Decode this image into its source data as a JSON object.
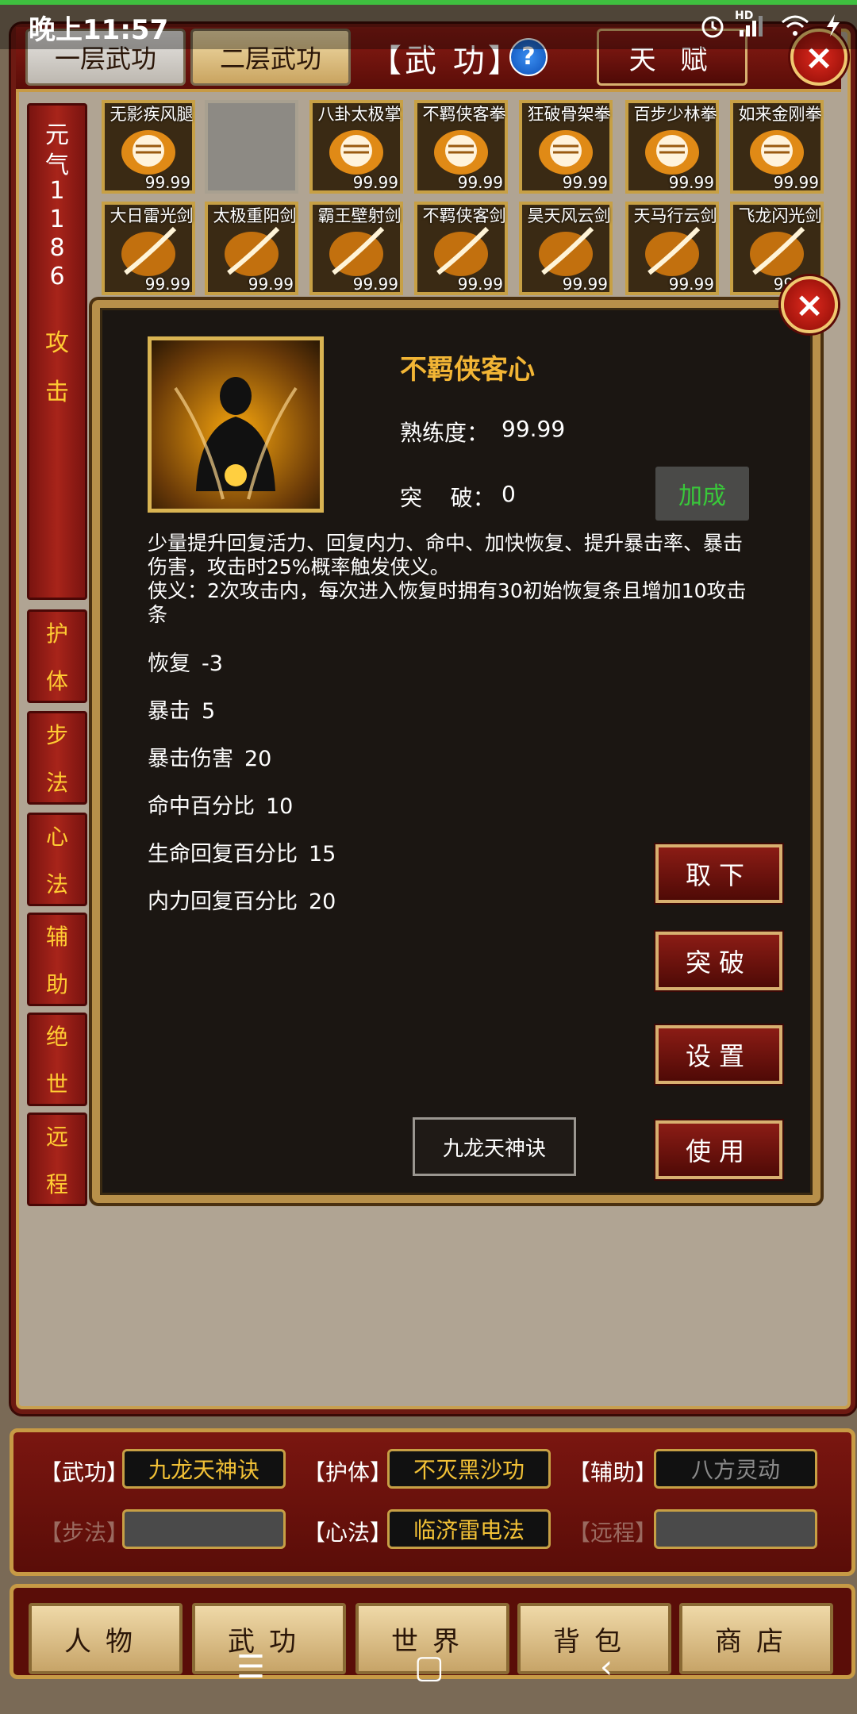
{
  "status_bar": {
    "time": "晚上11:57",
    "hd_label": "HD"
  },
  "header": {
    "tabs": [
      "一层武功",
      "二层武功"
    ],
    "title": "【武  功】",
    "help": "?",
    "talent_button": "天 赋"
  },
  "sidebar": {
    "energy_label": [
      "元",
      "气"
    ],
    "energy_value": [
      "1",
      "1",
      "8",
      "6"
    ],
    "attack_label": [
      "攻",
      "击"
    ],
    "categories": [
      [
        "护",
        "体"
      ],
      [
        "步",
        "法"
      ],
      [
        "心",
        "法"
      ],
      [
        "辅",
        "助"
      ],
      [
        "绝",
        "世"
      ],
      [
        "远",
        "程"
      ]
    ]
  },
  "skills_row1": [
    {
      "name": "无影疾风腿",
      "level": "99.99",
      "type": "fist"
    },
    {
      "name": "",
      "level": "",
      "type": "empty"
    },
    {
      "name": "八卦太极掌",
      "level": "99.99",
      "type": "fist"
    },
    {
      "name": "不羁侠客拳",
      "level": "99.99",
      "type": "fist"
    },
    {
      "name": "狂破骨架拳",
      "level": "99.99",
      "type": "fist"
    },
    {
      "name": "百步少林拳",
      "level": "99.99",
      "type": "fist"
    },
    {
      "name": "如来金刚拳",
      "level": "99.99",
      "type": "fist"
    }
  ],
  "skills_row2": [
    {
      "name": "大日雷光剑",
      "level": "99.99",
      "type": "sword"
    },
    {
      "name": "太极重阳剑",
      "level": "99.99",
      "type": "sword"
    },
    {
      "name": "霸王壁射剑",
      "level": "99.99",
      "type": "sword"
    },
    {
      "name": "不羁侠客剑",
      "level": "99.99",
      "type": "sword"
    },
    {
      "name": "昊天风云剑",
      "level": "99.99",
      "type": "sword"
    },
    {
      "name": "天马行云剑",
      "level": "99.99",
      "type": "sword"
    },
    {
      "name": "飞龙闪光剑",
      "level": "99.99",
      "type": "sword"
    }
  ],
  "dialog": {
    "title": "不羁侠客心",
    "proficiency_label": "熟练度：",
    "proficiency_value": "99.99",
    "breakthrough_label": "突    破：",
    "breakthrough_value": "0",
    "bonus_button": "加成",
    "description_1": "少量提升回复活力、回复内力、命中、加快恢复、提升暴击率、暴击伤害，攻击时25%概率触发侠义。",
    "description_2": "侠义：2次攻击内，每次进入恢复时拥有30初始恢复条且增加10攻击条",
    "stats": [
      {
        "label": "恢复",
        "value": "-3"
      },
      {
        "label": "暴击",
        "value": "5"
      },
      {
        "label": "暴击伤害",
        "value": "20"
      },
      {
        "label": "命中百分比",
        "value": "10"
      },
      {
        "label": "生命回复百分比",
        "value": "15"
      },
      {
        "label": "内力回复百分比",
        "value": "20"
      }
    ],
    "buttons": {
      "unequip": "取下",
      "breakthrough": "突破",
      "settings": "设置",
      "use": "使用"
    },
    "select_value": "九龙天神诀",
    "close": "×"
  },
  "equip": {
    "martial_label": "【武功】",
    "martial_value": "九龙天神诀",
    "body_label": "【护体】",
    "body_value": "不灭黑沙功",
    "assist_label": "【辅助】",
    "assist_value": "八方灵动",
    "step_label": "【步法】",
    "step_value": "",
    "heart_label": "【心法】",
    "heart_value": "临济雷电法",
    "ranged_label": "【远程】",
    "ranged_value": ""
  },
  "nav": [
    "人物",
    "武功",
    "世界",
    "背包",
    "商店"
  ],
  "colors": {
    "accent_gold": "#f2b535",
    "frame_red": "#8a1c14",
    "bonus_green": "#39c83a"
  }
}
